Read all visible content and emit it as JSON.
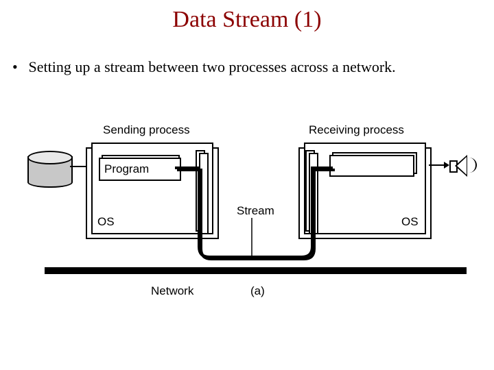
{
  "title": "Data Stream (1)",
  "bullet": "Setting up a stream between two processes across a network.",
  "diagram": {
    "sending_label": "Sending process",
    "receiving_label": "Receiving process",
    "program_label": "Program",
    "stream_label": "Stream",
    "os_label_left": "OS",
    "os_label_right": "OS",
    "network_label": "Network",
    "caption": "(a)"
  }
}
